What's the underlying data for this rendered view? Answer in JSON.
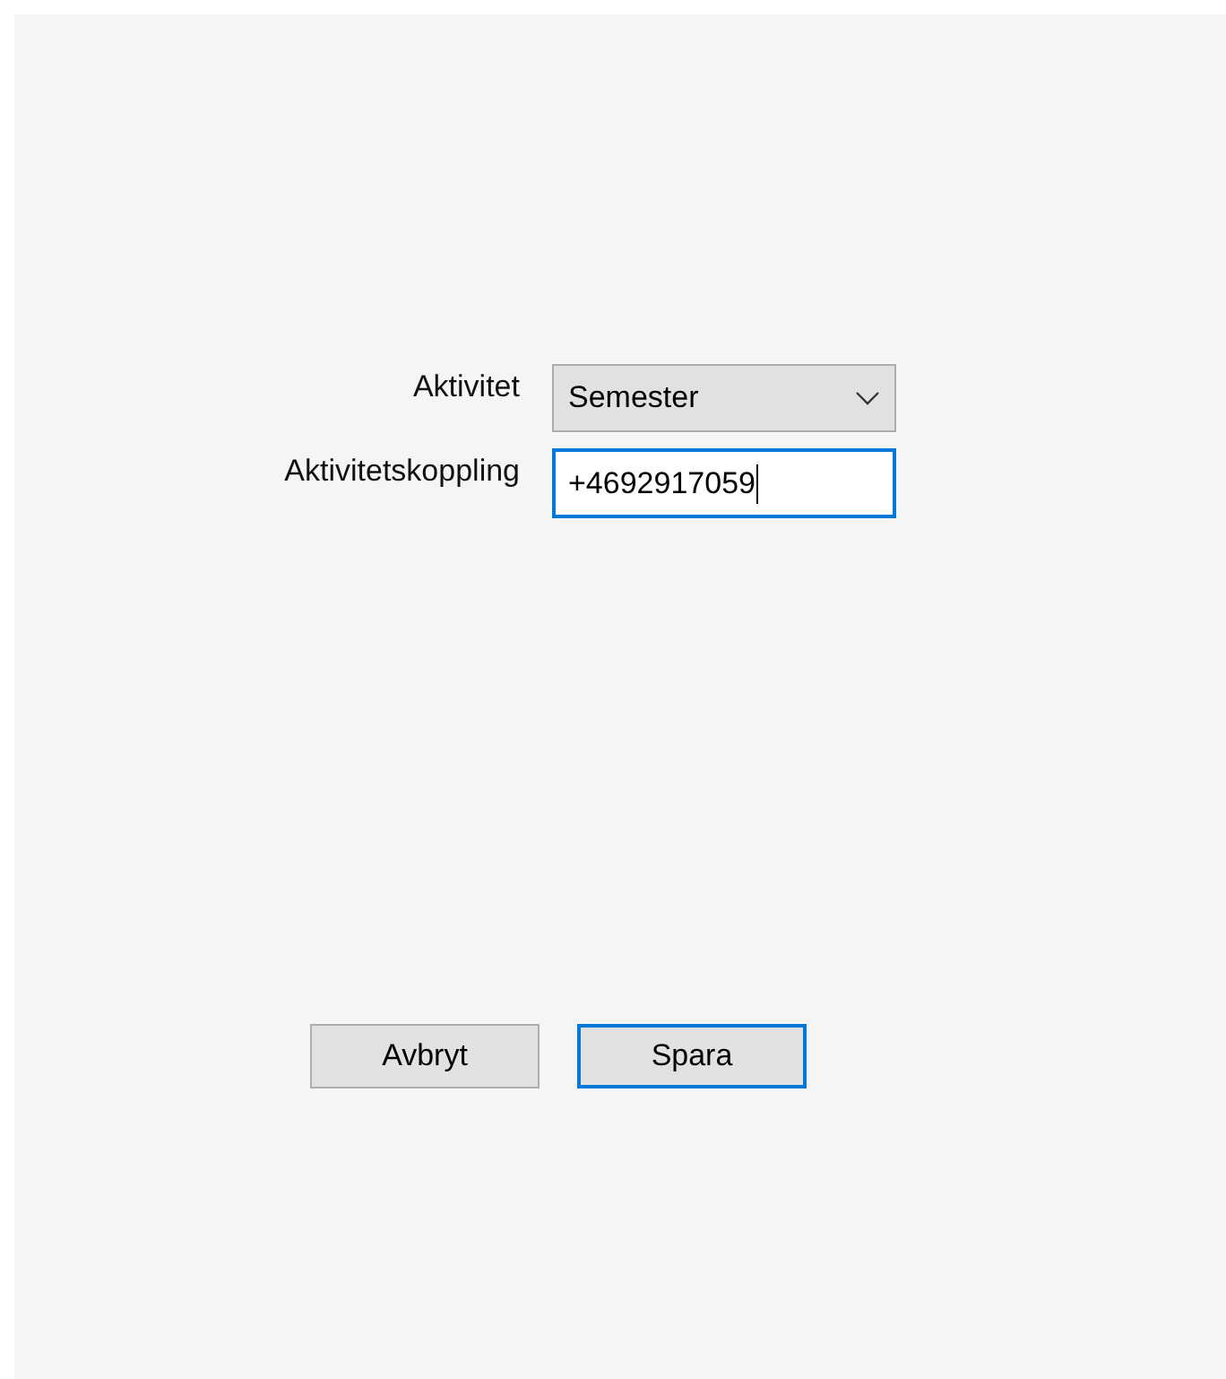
{
  "form": {
    "activity": {
      "label": "Aktivitet",
      "value": "Semester"
    },
    "link": {
      "label": "Aktivitetskoppling",
      "value": "+4692917059",
      "focused": true
    }
  },
  "buttons": [
    {
      "label": "Avbryt",
      "default": false
    },
    {
      "label": "Spara",
      "default": true
    }
  ]
}
